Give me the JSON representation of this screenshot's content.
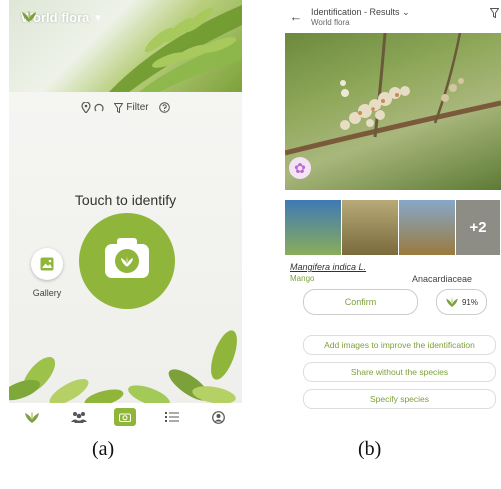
{
  "panel_a": {
    "app_title": "World flora",
    "toolbar": {
      "filter_label": "Filter"
    },
    "prompt": "Touch to identify",
    "gallery_label": "Gallery",
    "nav": [
      "plant-icon",
      "community-icon",
      "camera-icon",
      "list-icon",
      "profile-icon"
    ]
  },
  "panel_b": {
    "header_title": "Identification - Results",
    "header_subtitle": "World flora",
    "thumbs_more": "+2",
    "result": {
      "species": "Mangifera indica L.",
      "common_name": "Mango",
      "family": "Anacardiaceae",
      "confirm_label": "Confirm",
      "score": "91%"
    },
    "actions": [
      "Add images to improve the identification",
      "Share without the species",
      "Specify species"
    ]
  },
  "captions": [
    "(a)",
    "(b)"
  ],
  "colors": {
    "accent": "#8fb53b",
    "accent_text": "#7da13a"
  }
}
